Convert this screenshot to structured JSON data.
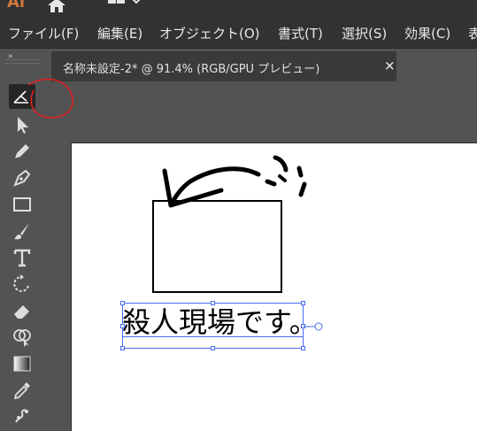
{
  "app": {
    "logo": "Ai",
    "accent": "#d2773c"
  },
  "menubar": {
    "items": [
      {
        "label": "ファイル(F)"
      },
      {
        "label": "編集(E)"
      },
      {
        "label": "オブジェクト(O)"
      },
      {
        "label": "書式(T)"
      },
      {
        "label": "選択(S)"
      },
      {
        "label": "効果(C)"
      },
      {
        "label": "表"
      }
    ]
  },
  "document_tab": {
    "title": "名称未設定-2* @ 91.4% (RGB/GPU プレビュー)",
    "close_label": "×"
  },
  "toolbar": {
    "grip": "»",
    "tools": [
      {
        "name": "shaper-tool-icon",
        "active": true
      },
      {
        "name": "selection-tool-icon"
      },
      {
        "name": "pencil-tool-icon"
      },
      {
        "name": "pen-tool-icon"
      },
      {
        "name": "rectangle-tool-icon"
      },
      {
        "name": "paintbrush-tool-icon"
      },
      {
        "name": "type-tool-icon"
      },
      {
        "name": "rotate-tool-icon"
      },
      {
        "name": "eraser-tool-icon"
      },
      {
        "name": "shape-builder-tool-icon"
      },
      {
        "name": "gradient-tool-icon"
      },
      {
        "name": "eyedropper-tool-icon"
      },
      {
        "name": "puppet-warp-tool-icon"
      }
    ]
  },
  "artboard": {
    "text": "殺人現場です。"
  },
  "annotation_color": "#e02020",
  "selection_color": "#4a6cf0"
}
